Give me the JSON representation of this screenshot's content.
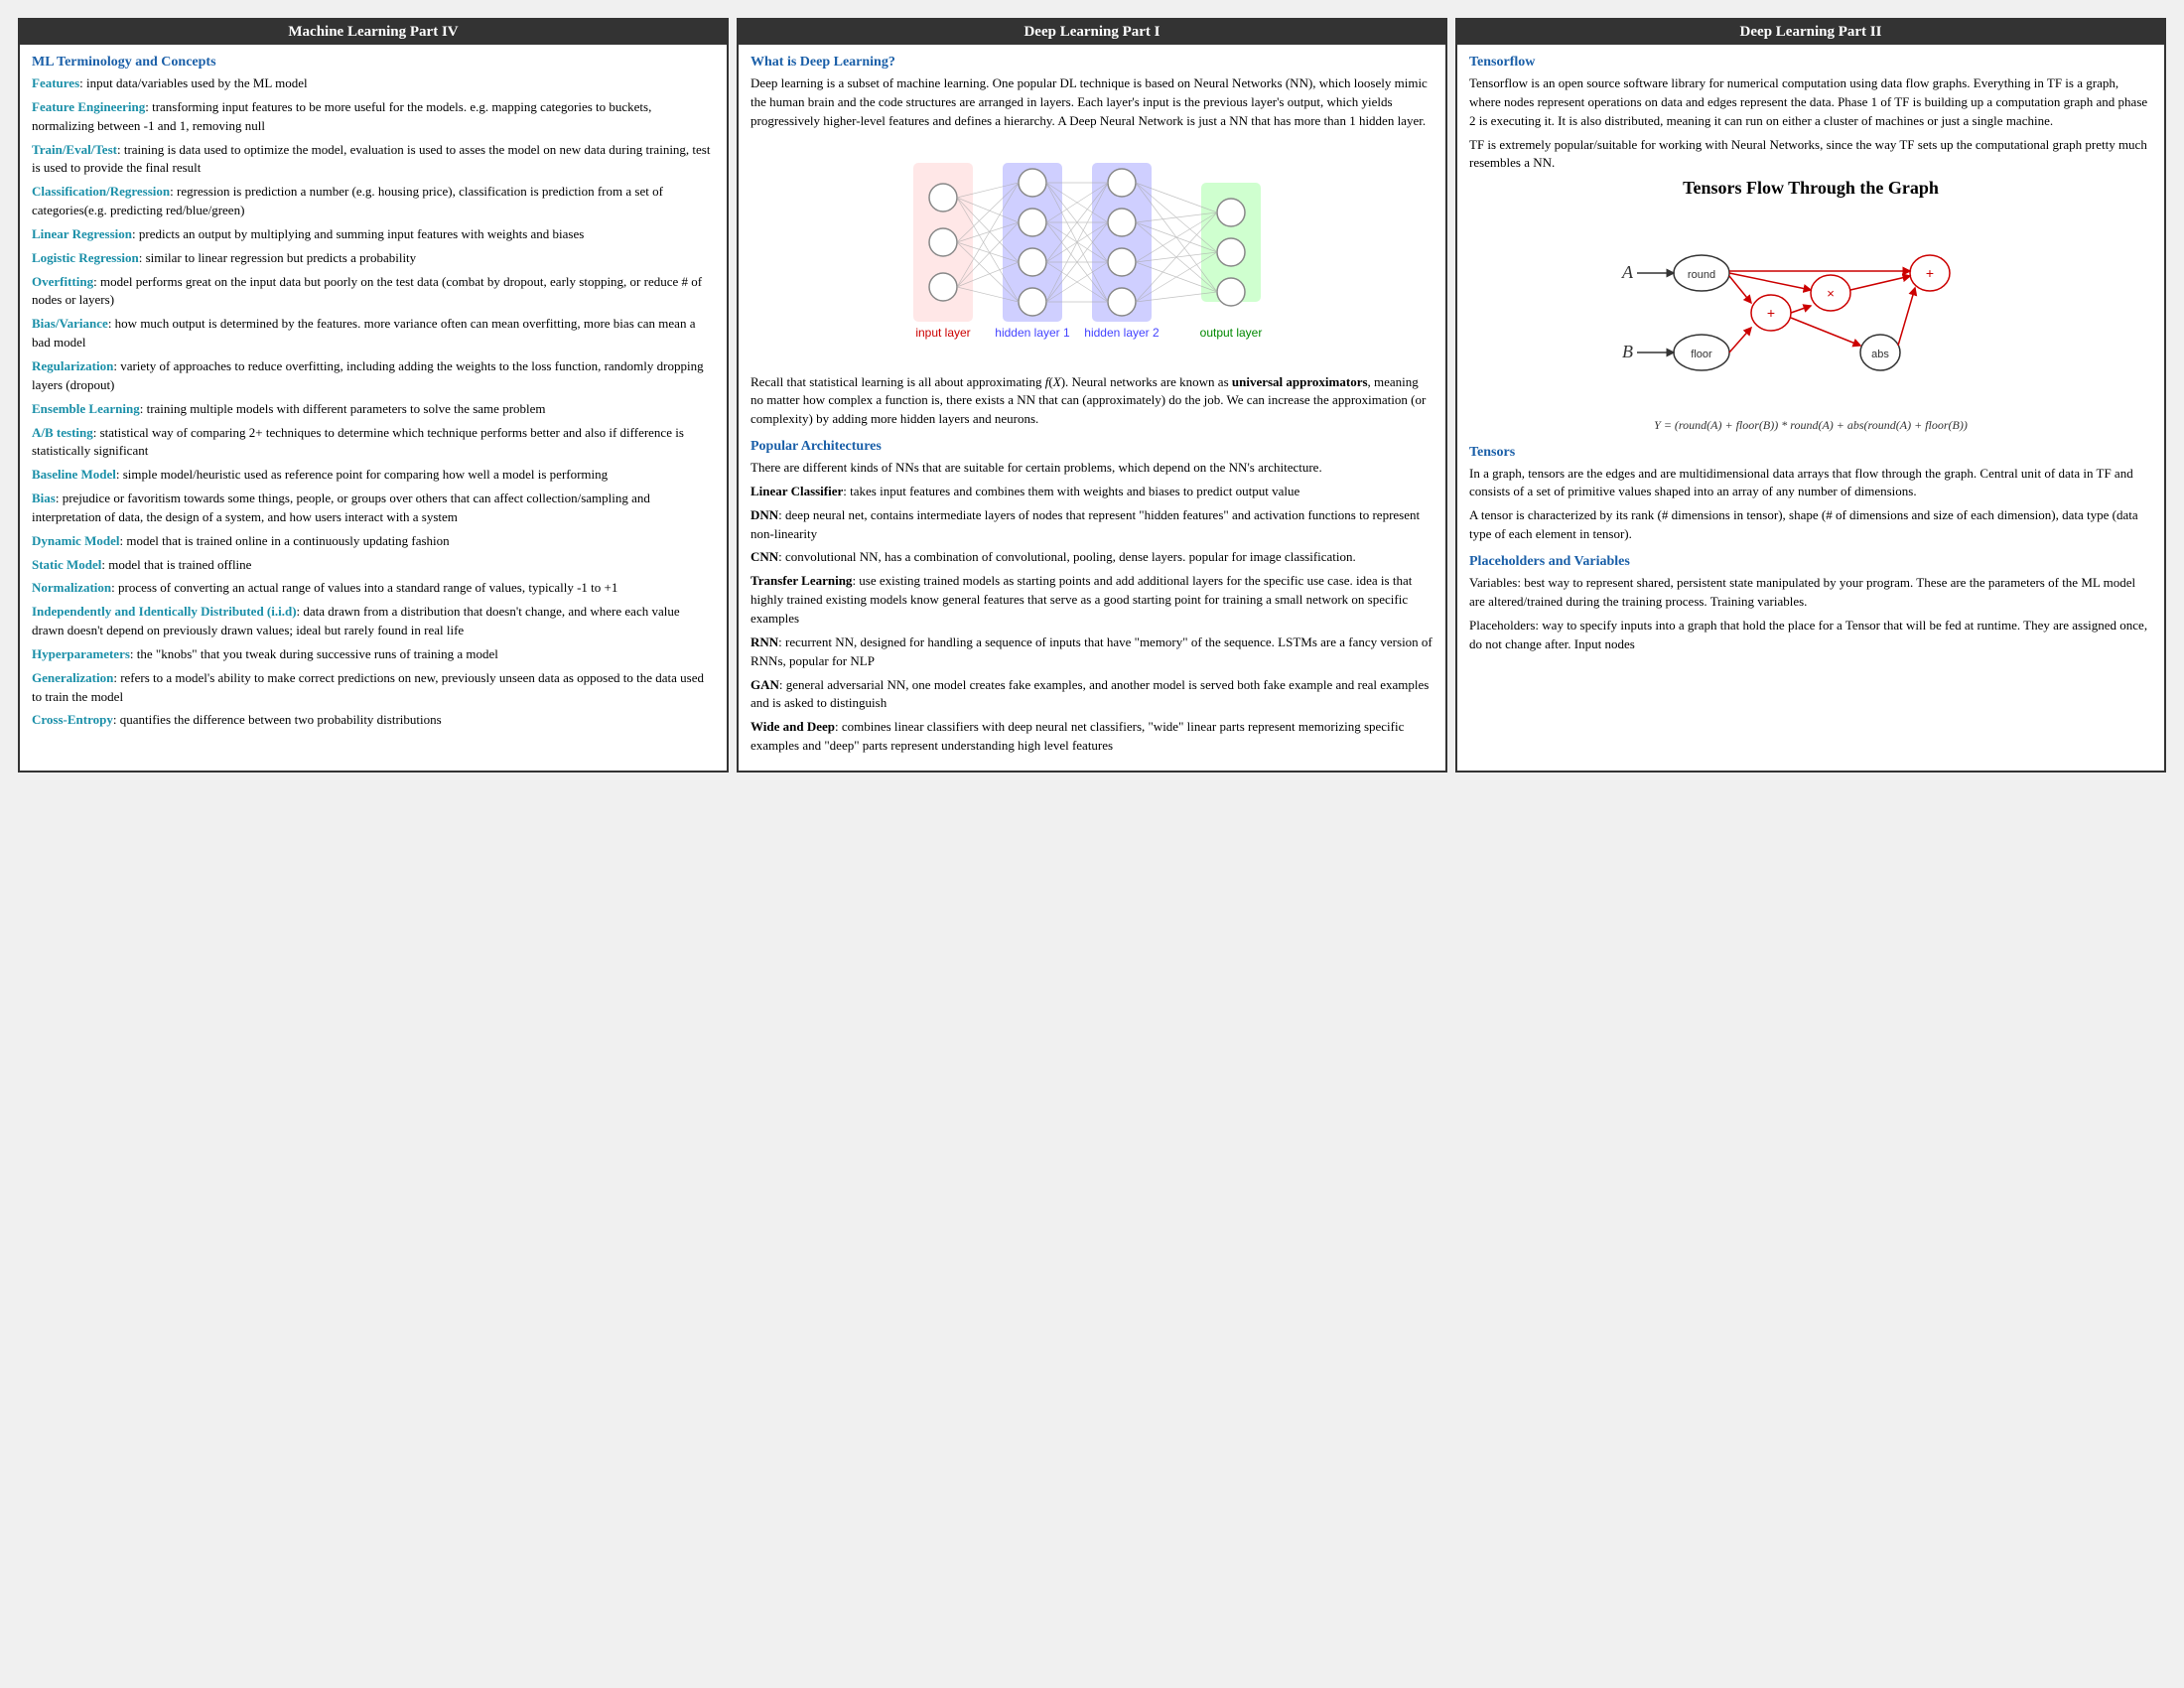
{
  "panel1": {
    "title": "Machine Learning Part IV",
    "heading1": "ML Terminology and Concepts",
    "items": [
      {
        "term": "Features",
        "def": ": input data/variables used by the ML model"
      },
      {
        "term": "Feature Engineering",
        "def": ": transforming input features to be more useful for the models. e.g. mapping categories to buckets, normalizing between -1 and 1, removing null"
      },
      {
        "term": "Train/Eval/Test",
        "def": ": training is data used to optimize the model, evaluation is used to asses the model on new data during training, test is used to provide the final result"
      },
      {
        "term": "Classification/Regression",
        "def": ": regression is prediction a number (e.g. housing price), classification is prediction from a set of categories(e.g. predicting red/blue/green)"
      },
      {
        "term": "Linear Regression",
        "def": ": predicts an output by multiplying and summing input features with weights and biases"
      },
      {
        "term": "Logistic Regression",
        "def": ": similar to linear regression but predicts a probability"
      },
      {
        "term": "Overfitting",
        "def": ": model performs great on the input data but poorly on the test data (combat by dropout, early stopping, or reduce # of nodes or layers)"
      },
      {
        "term": "Bias/Variance",
        "def": ": how much output is determined by the features. more variance often can mean overfitting, more bias can mean a bad model"
      },
      {
        "term": "Regularization",
        "def": ": variety of approaches to reduce overfitting, including adding the weights to the loss function, randomly dropping layers (dropout)"
      },
      {
        "term": "Ensemble Learning",
        "def": ": training multiple models with different parameters to solve the same problem"
      },
      {
        "term": "A/B testing",
        "def": ": statistical way of comparing 2+ techniques to determine which technique performs better and also if difference is statistically significant"
      },
      {
        "term": "Baseline Model",
        "def": ": simple model/heuristic used as reference point for comparing how well a model is performing"
      },
      {
        "term": "Bias",
        "def": ": prejudice or favoritism towards some things, people, or groups over others that can affect collection/sampling and interpretation of data, the design of a system, and how users interact with a system"
      },
      {
        "term": "Dynamic Model",
        "def": ": model that is trained online in a continuously updating fashion"
      },
      {
        "term": "Static Model",
        "def": ": model that is trained offline"
      },
      {
        "term": "Normalization",
        "def": ": process of converting an actual range of values into a standard range of values, typically -1 to +1"
      },
      {
        "term": "Independently and Identically Distributed (i.i.d)",
        "def": ": data drawn from a distribution that doesn't change, and where each value drawn doesn't depend on previously drawn values; ideal but rarely found in real life"
      },
      {
        "term": "Hyperparameters",
        "def": ": the \"knobs\" that you tweak during successive runs of training a model"
      },
      {
        "term": "Generalization",
        "def": ": refers to a model's ability to make correct predictions on new, previously unseen data as opposed to the data used to train the model"
      },
      {
        "term": "Cross-Entropy",
        "def": ": quantifies the difference between two probability distributions"
      }
    ]
  },
  "panel2": {
    "title": "Deep Learning Part I",
    "heading1": "What is Deep Learning?",
    "intro": "Deep learning is a subset of machine learning. One popular DL technique is based on Neural Networks (NN), which loosely mimic the human brain and the code structures are arranged in layers. Each layer's input is the previous layer's output, which yields progressively higher-level features and defines a hierarchy. A Deep Neural Network is just a NN that has more than 1 hidden layer.",
    "layer_labels": {
      "input": "input layer",
      "hidden1": "hidden layer 1",
      "hidden2": "hidden layer 2",
      "output": "output layer"
    },
    "universal_text": "Recall that statistical learning is all about approximating f(X). Neural networks are known as universal approximators, meaning no matter how complex a function is, there exists a NN that can (approximately) do the job. We can increase the approximation (or complexity) by adding more hidden layers and neurons.",
    "heading2": "Popular Architectures",
    "arch_intro": "There are different kinds of NNs that are suitable for certain problems, which depend on the NN's architecture.",
    "architectures": [
      {
        "name": "Linear Classifier",
        "def": ": takes input features and combines them with weights and biases to predict output value"
      },
      {
        "name": "DNN",
        "def": ": deep neural net, contains intermediate layers of nodes that represent \"hidden features\" and activation functions to represent non-linearity"
      },
      {
        "name": "CNN",
        "def": ": convolutional NN, has a combination of convolutional, pooling, dense layers. popular for image classification."
      },
      {
        "name": "Transfer Learning",
        "def": ": use existing trained models as starting points and add additional layers for the specific use case. idea is that highly trained existing models know general features that serve as a good starting point for training a small network on specific examples"
      },
      {
        "name": "RNN",
        "def": ": recurrent NN, designed for handling a sequence of inputs that have \"memory\" of the sequence. LSTMs are a fancy version of RNNs, popular for NLP"
      },
      {
        "name": "GAN",
        "def": ": general adversarial NN, one model creates fake examples, and another model is served both fake example and real examples and is asked to distinguish"
      },
      {
        "name": "Wide and Deep",
        "def": ": combines linear classifiers with deep neural net classifiers, \"wide\" linear parts represent memorizing specific examples and \"deep\" parts represent understanding high level features"
      }
    ]
  },
  "panel3": {
    "title": "Deep Learning Part II",
    "heading1": "Tensorflow",
    "tf_text1": "Tensorflow is an open source software library for numerical computation using data flow graphs. Everything in TF is a graph, where nodes represent operations on data and edges represent the data. Phase 1 of TF is building up a computation graph and phase 2 is executing it. It is also distributed, meaning it can run on either a cluster of machines or just a single machine.",
    "tf_text2": "TF is extremely popular/suitable for working with Neural Networks, since the way TF sets up the computational graph pretty much resembles a NN.",
    "graph_title": "Tensors Flow Through the Graph",
    "formula": "Y = (round(A) + floor(B)) * round(A) + abs(round(A) + floor(B))",
    "heading2": "Tensors",
    "tensors_text1": "In a graph, tensors are the edges and are multidimensional data arrays that flow through the graph. Central unit of data in TF and consists of a set of primitive values shaped into an array of any number of dimensions.",
    "tensors_text2": "A tensor is characterized by its rank (# dimensions in tensor), shape (# of dimensions and size of each dimension), data type (data type of each element in tensor).",
    "heading3": "Placeholders and Variables",
    "vars_text": "Variables: best way to represent shared, persistent state manipulated by your program. These are the parameters of the ML model are altered/trained during the training process. Training variables.",
    "placeholders_text": "Placeholders: way to specify inputs into a graph that hold the place for a Tensor that will be fed at runtime. They are assigned once, do not change after. Input nodes"
  }
}
